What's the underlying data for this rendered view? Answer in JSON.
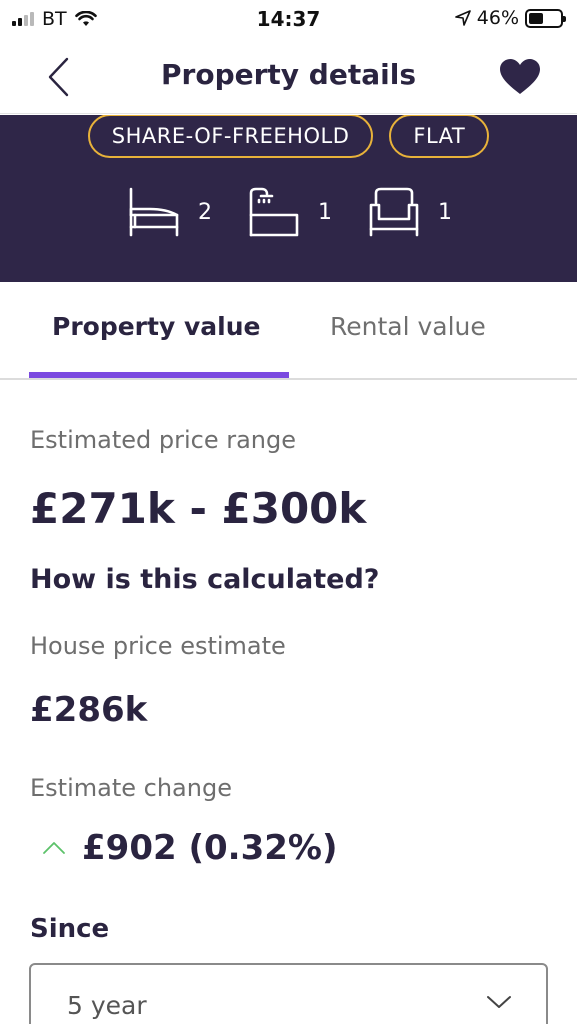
{
  "status": {
    "carrier": "BT",
    "time": "14:37",
    "battery": "46%",
    "battery_level": 0.46
  },
  "nav": {
    "title": "Property details"
  },
  "hero": {
    "tags": [
      "SHARE-OF-FREEHOLD",
      "FLAT"
    ],
    "bedrooms": "2",
    "bathrooms": "1",
    "reception_rooms": "1"
  },
  "tabs": {
    "property": "Property value",
    "rental": "Rental value"
  },
  "valuation": {
    "range_label": "Estimated price range",
    "range_value": "£271k - £300k",
    "calc_heading": "How is this calculated?",
    "estimate_label": "House price estimate",
    "estimate_value": "£286k",
    "change_label": "Estimate change",
    "change_value": "£902 (0.32%)",
    "since_label": "Since",
    "since_selected": "5 year"
  },
  "colors": {
    "hero_background": "#2f2648",
    "tag_border": "#e8b23a",
    "tab_accent": "#7b4ae0",
    "change_up": "#5cc26a",
    "primary_text": "#2a2440"
  }
}
